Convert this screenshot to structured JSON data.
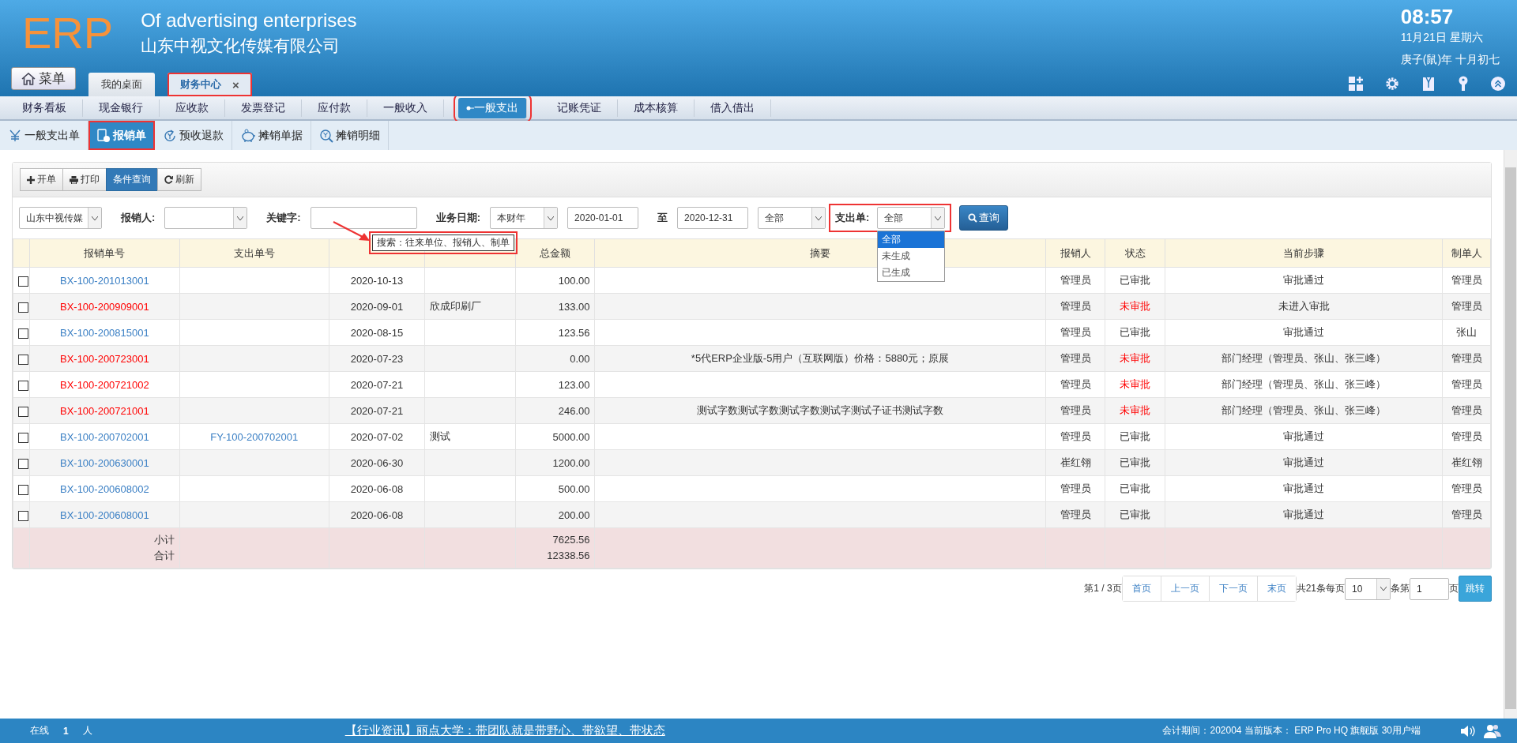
{
  "brand": {
    "logo": "ERP",
    "tagline": "Of advertising enterprises",
    "company": "山东中视文化传媒有限公司"
  },
  "clock": {
    "time": "08:57",
    "date": "11月21日 星期六",
    "lunar": "庚子(鼠)年 十月初七"
  },
  "menu_button": "菜单",
  "window_tabs": [
    {
      "label": "我的桌面",
      "selected": false,
      "highlighted": false
    },
    {
      "label": "财务中心",
      "selected": true,
      "highlighted": true,
      "close": "×"
    }
  ],
  "nav": [
    {
      "label": "财务看板",
      "selected": false,
      "highlighted": false
    },
    {
      "label": "现金银行",
      "selected": false,
      "highlighted": false
    },
    {
      "label": "应收款",
      "selected": false,
      "highlighted": false
    },
    {
      "label": "发票登记",
      "selected": false,
      "highlighted": false
    },
    {
      "label": "应付款",
      "selected": false,
      "highlighted": false
    },
    {
      "label": "一般收入",
      "selected": false,
      "highlighted": false
    },
    {
      "label": "一般支出",
      "selected": true,
      "highlighted": true
    },
    {
      "label": "记账凭证",
      "selected": false,
      "highlighted": false
    },
    {
      "label": "成本核算",
      "selected": false,
      "highlighted": false
    },
    {
      "label": "借入借出",
      "selected": false,
      "highlighted": false
    }
  ],
  "subtabs": [
    {
      "label": "一般支出单",
      "kind": "yen",
      "selected": false,
      "highlighted": false
    },
    {
      "label": "报销单",
      "kind": "doc",
      "selected": true,
      "highlighted": true
    },
    {
      "label": "预收退款",
      "kind": "refund",
      "selected": false,
      "highlighted": false
    },
    {
      "label": "摊销单据",
      "kind": "piggy",
      "selected": false,
      "highlighted": false
    },
    {
      "label": "摊销明细",
      "kind": "search",
      "selected": false,
      "highlighted": false
    }
  ],
  "toolbar": [
    {
      "label": "开单",
      "kind": "plus",
      "selected": false
    },
    {
      "label": "打印",
      "kind": "print",
      "selected": false
    },
    {
      "label": "条件查询",
      "kind": "none",
      "selected": true
    },
    {
      "label": "刷新",
      "kind": "refresh",
      "selected": false
    }
  ],
  "filters": {
    "company": "山东中视传媒",
    "reimburser_label": "报销人:",
    "keyword_label": "关键字:",
    "date_label": "业务日期:",
    "period": "本财年",
    "date_from": "2020-01-01",
    "to_label": "至",
    "date_to": "2020-12-31",
    "scope": "全部",
    "payment_label": "支出单:",
    "payment_value": "全部",
    "search_button": "查询",
    "payment_options": [
      {
        "label": "全部",
        "selected": true
      },
      {
        "label": "未生成",
        "selected": false
      },
      {
        "label": "已生成",
        "selected": false
      }
    ]
  },
  "tooltip": "搜索：往来单位、报销人、制单",
  "table": {
    "columns": [
      "报销单号",
      "支出单号",
      "",
      "",
      "总金额",
      "摘要",
      "报销人",
      "状态",
      "当前步骤",
      "制单人"
    ],
    "rows": [
      {
        "checked": false,
        "flagged": false,
        "number": "BX-100-201013001",
        "payment_no": "",
        "date": "2020-10-13",
        "column_4": "",
        "amount": "100.00",
        "summary": "",
        "reimburser": "管理员",
        "status": "已审批",
        "step": "审批通过",
        "creator": "管理员"
      },
      {
        "checked": false,
        "flagged": true,
        "number": "BX-100-200909001",
        "payment_no": "",
        "date": "2020-09-01",
        "column_4": "欣成印刷厂",
        "amount": "133.00",
        "summary": "",
        "reimburser": "管理员",
        "status": "未审批",
        "step": "未进入审批",
        "creator": "管理员"
      },
      {
        "checked": false,
        "flagged": false,
        "number": "BX-100-200815001",
        "payment_no": "",
        "date": "2020-08-15",
        "column_4": "",
        "amount": "123.56",
        "summary": "",
        "reimburser": "管理员",
        "status": "已审批",
        "step": "审批通过",
        "creator": "张山"
      },
      {
        "checked": false,
        "flagged": true,
        "number": "BX-100-200723001",
        "payment_no": "",
        "date": "2020-07-23",
        "column_4": "",
        "amount": "0.00",
        "summary": "*5代ERP企业版-5用户（互联网版）价格：5880元；原展",
        "reimburser": "管理员",
        "status": "未审批",
        "step": "部门经理（管理员、张山、张三峰）",
        "creator": "管理员"
      },
      {
        "checked": false,
        "flagged": true,
        "number": "BX-100-200721002",
        "payment_no": "",
        "date": "2020-07-21",
        "column_4": "",
        "amount": "123.00",
        "summary": "",
        "reimburser": "管理员",
        "status": "未审批",
        "step": "部门经理（管理员、张山、张三峰）",
        "creator": "管理员"
      },
      {
        "checked": false,
        "flagged": true,
        "number": "BX-100-200721001",
        "payment_no": "",
        "date": "2020-07-21",
        "column_4": "",
        "amount": "246.00",
        "summary": "测试字数测试字数测试字数测试字测试子证书测试字数",
        "reimburser": "管理员",
        "status": "未审批",
        "step": "部门经理（管理员、张山、张三峰）",
        "creator": "管理员"
      },
      {
        "checked": false,
        "flagged": false,
        "number": "BX-100-200702001",
        "payment_no": "FY-100-200702001",
        "date": "2020-07-02",
        "column_4": "测试",
        "amount": "5000.00",
        "summary": "",
        "reimburser": "管理员",
        "status": "已审批",
        "step": "审批通过",
        "creator": "管理员"
      },
      {
        "checked": false,
        "flagged": false,
        "number": "BX-100-200630001",
        "payment_no": "",
        "date": "2020-06-30",
        "column_4": "",
        "amount": "1200.00",
        "summary": "",
        "reimburser": "崔红翎",
        "status": "已审批",
        "step": "审批通过",
        "creator": "崔红翎"
      },
      {
        "checked": false,
        "flagged": false,
        "number": "BX-100-200608002",
        "payment_no": "",
        "date": "2020-06-08",
        "column_4": "",
        "amount": "500.00",
        "summary": "",
        "reimburser": "管理员",
        "status": "已审批",
        "step": "审批通过",
        "creator": "管理员"
      },
      {
        "checked": false,
        "flagged": false,
        "number": "BX-100-200608001",
        "payment_no": "",
        "date": "2020-06-08",
        "column_4": "",
        "amount": "200.00",
        "summary": "",
        "reimburser": "管理员",
        "status": "已审批",
        "step": "审批通过",
        "creator": "管理员"
      }
    ],
    "subtotal_label": "小计",
    "total_label": "合计",
    "subtotal": "7625.56",
    "total": "12338.56"
  },
  "pagination": {
    "page_info": "第1 / 3页",
    "buttons": [
      "首页",
      "上一页",
      "下一页",
      "末页"
    ],
    "count_text": "共21条每页",
    "page_size": "10",
    "goto_text": "条第",
    "page_input": "1",
    "page_suffix": "页",
    "go_button": "跳转"
  },
  "status_bar": {
    "online_label": "在线",
    "online_count": "1",
    "online_unit": "人",
    "news": "【行业资讯】丽点大学：带团队就是带野心、带欲望、带状态",
    "info": "会计期间：202004 当前版本： ERP Pro HQ 旗舰版 30用户端"
  }
}
